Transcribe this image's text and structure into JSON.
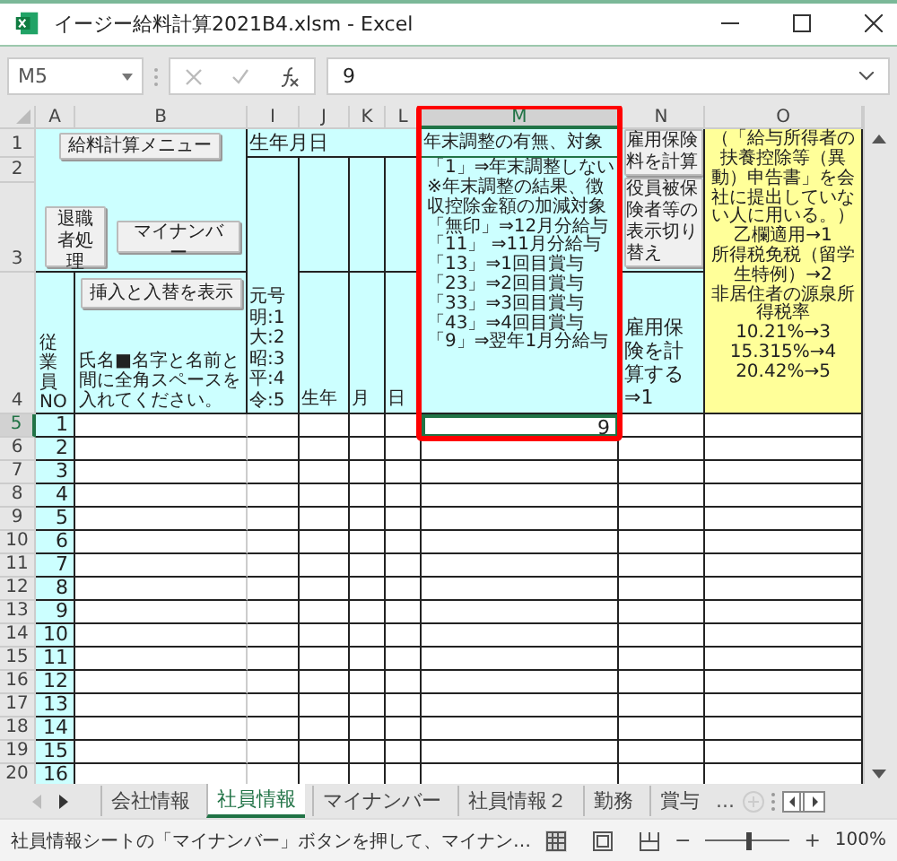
{
  "window": {
    "title": "イージー給料計算2021B4.xlsm - Excel"
  },
  "formula_bar": {
    "name_box": "M5",
    "value": "9"
  },
  "columns": [
    {
      "label": "A",
      "selected": false
    },
    {
      "label": "B",
      "selected": false
    },
    {
      "label": "I",
      "selected": false
    },
    {
      "label": "J",
      "selected": false
    },
    {
      "label": "K",
      "selected": false
    },
    {
      "label": "L",
      "selected": false
    },
    {
      "label": "M",
      "selected": true
    },
    {
      "label": "N",
      "selected": false
    },
    {
      "label": "O",
      "selected": false
    }
  ],
  "header_rows": [
    "1",
    "2",
    "3",
    "4"
  ],
  "sheet": {
    "menu_button": "給料計算メニュー",
    "retire_button": "退職者処理",
    "mynumber_button": "マイナンバー",
    "insert_button": "挿入と入替を表示",
    "employee_no_label": "従業員NO",
    "name_note": "氏名■名字と名前と間に全角スペースを入れてください。",
    "birth_title": "生年月日",
    "era_legend": "元号明:1大:2昭:3平:4令:5",
    "birth_parts": [
      "生年",
      "月",
      "日"
    ],
    "m_title": "年末調整の有無、対象",
    "m_lines": [
      "「1」⇒年末調整しない",
      "※年末調整の結果、徴収控除金額の加減対象",
      "「無印」⇒12月分給与",
      "「11」 ⇒11月分給与",
      "「13」⇒1回目賞与",
      "「23」⇒2回目賞与",
      "「33」⇒3回目賞与",
      "「43」⇒4回目賞与",
      "「9」⇒翌年1月分給与"
    ],
    "n_buttons": [
      "雇用保険料を計算",
      "役員被保険者等の表示切り替え"
    ],
    "n_note": "雇用保険を計算する⇒1",
    "o_lines": [
      "（「給与所得者の扶養控除等（異動）申告書」を会社に提出していない人に用いる。）",
      "乙欄適用→1",
      "所得税免税（留学生特例）→2",
      "非居住者の源泉所得税率",
      "10.21%→3",
      "15.315%→4",
      "20.42%→5"
    ]
  },
  "rows": [
    {
      "header": "5",
      "no": "1",
      "m": "9",
      "selected": true
    },
    {
      "header": "6",
      "no": "2",
      "selected": false
    },
    {
      "header": "7",
      "no": "3",
      "selected": false
    },
    {
      "header": "8",
      "no": "4",
      "selected": false
    },
    {
      "header": "9",
      "no": "5",
      "selected": false
    },
    {
      "header": "10",
      "no": "6",
      "selected": false
    },
    {
      "header": "11",
      "no": "7",
      "selected": false
    },
    {
      "header": "12",
      "no": "8",
      "selected": false
    },
    {
      "header": "13",
      "no": "9",
      "selected": false
    },
    {
      "header": "14",
      "no": "10",
      "selected": false
    },
    {
      "header": "15",
      "no": "11",
      "selected": false
    },
    {
      "header": "16",
      "no": "12",
      "selected": false
    },
    {
      "header": "17",
      "no": "13",
      "selected": false
    },
    {
      "header": "18",
      "no": "14",
      "selected": false
    },
    {
      "header": "19",
      "no": "15",
      "selected": false
    },
    {
      "header": "20",
      "no": "16",
      "selected": false
    }
  ],
  "tabs": [
    {
      "label": "会社情報",
      "selected": false
    },
    {
      "label": "社員情報",
      "selected": true
    },
    {
      "label": "マイナンバー",
      "selected": false
    },
    {
      "label": "社員情報２",
      "selected": false
    },
    {
      "label": "勤務",
      "selected": false
    },
    {
      "label": "賞与",
      "selected": false
    }
  ],
  "more_tabs": "...",
  "status_bar": {
    "message": "社員情報シートの「マイナンバー」ボタンを押して、マイナン…",
    "zoom_minus": "−",
    "zoom_plus": "+",
    "zoom_slider": {
      "level": 0.5
    },
    "zoom_label": "100%"
  }
}
